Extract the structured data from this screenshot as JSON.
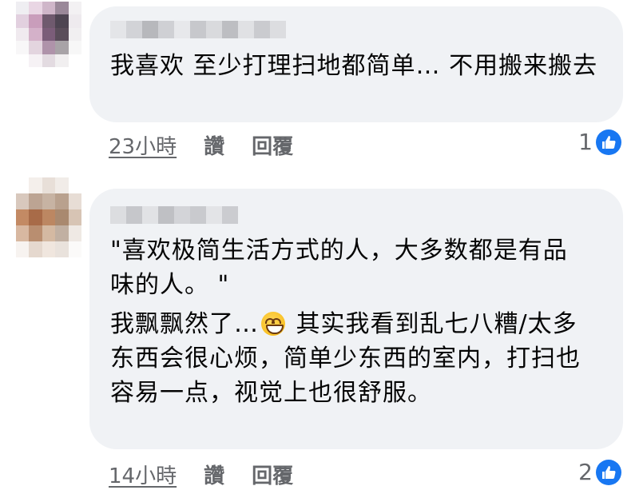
{
  "comments": [
    {
      "text_lines": [
        "我喜欢 至少打理扫地都简单… 不用搬来搬去"
      ],
      "time": "23小時",
      "like_label": "讚",
      "reply_label": "回覆",
      "reaction_count": "1",
      "reaction_icon": "thumbs-up-icon"
    },
    {
      "text_lines": [
        "\"喜欢极简生活方式的人，大多数都是有品味的人。 \"",
        "我飘飘然了…",
        " 其实我看到乱七八糟/太多东西会很心烦，简单少东西的室内，打扫也容易一点，视觉上也很舒服。"
      ],
      "emoji": "grinning-face-icon",
      "time": "14小時",
      "like_label": "讚",
      "reply_label": "回覆",
      "reaction_count": "2",
      "reaction_icon": "thumbs-up-icon"
    }
  ],
  "colors": {
    "bubble": "#f0f2f5",
    "meta_text": "#65676b",
    "like_blue": "#1877f2"
  }
}
